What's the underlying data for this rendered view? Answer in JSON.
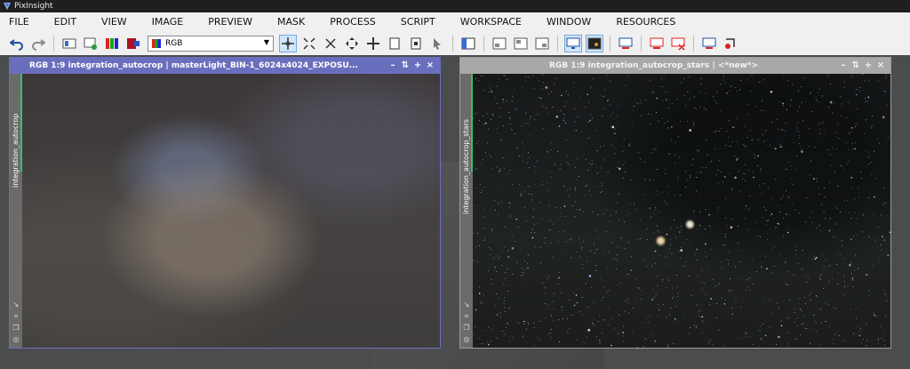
{
  "app": {
    "title": "PixInsight"
  },
  "menu": [
    "FILE",
    "EDIT",
    "VIEW",
    "IMAGE",
    "PREVIEW",
    "MASK",
    "PROCESS",
    "SCRIPT",
    "WORKSPACE",
    "WINDOW",
    "RESOURCES"
  ],
  "toolbar": {
    "icons": [
      "undo-icon",
      "redo-icon",
      "sep",
      "image-info-icon",
      "image-new-icon",
      "color-channels-icon",
      "color-target-icon",
      "combo",
      "pan-mode-icon",
      "zoom-fit-icon",
      "zoom-in-mode-icon",
      "move-mode-icon",
      "navigate-mode-icon",
      "page-icon",
      "page-edit-icon",
      "pointer-icon",
      "sep",
      "window-list-icon",
      "sep",
      "window-a-icon",
      "window-b-icon",
      "window-c-icon",
      "sep",
      "display-monitor-icon",
      "display-active-icon",
      "sep",
      "screen-icon",
      "sep",
      "mask-red-icon",
      "mask-red-x-icon",
      "sep",
      "screen-mask-icon",
      "transfer-icon"
    ],
    "combo": {
      "value": "RGB"
    }
  },
  "windows": [
    {
      "title": "RGB 1:9 integration_autocrop | masterLight_BIN-1_6024x4024_EXPOSU...",
      "side_label": "integration_autocrop",
      "active": true
    },
    {
      "title": "RGB 1:9 integration_autocrop_stars | <*new*>",
      "side_label": "integration_autocrop_stars",
      "active": false
    }
  ],
  "window_controls": [
    "–",
    "⇅",
    "+",
    "×"
  ]
}
